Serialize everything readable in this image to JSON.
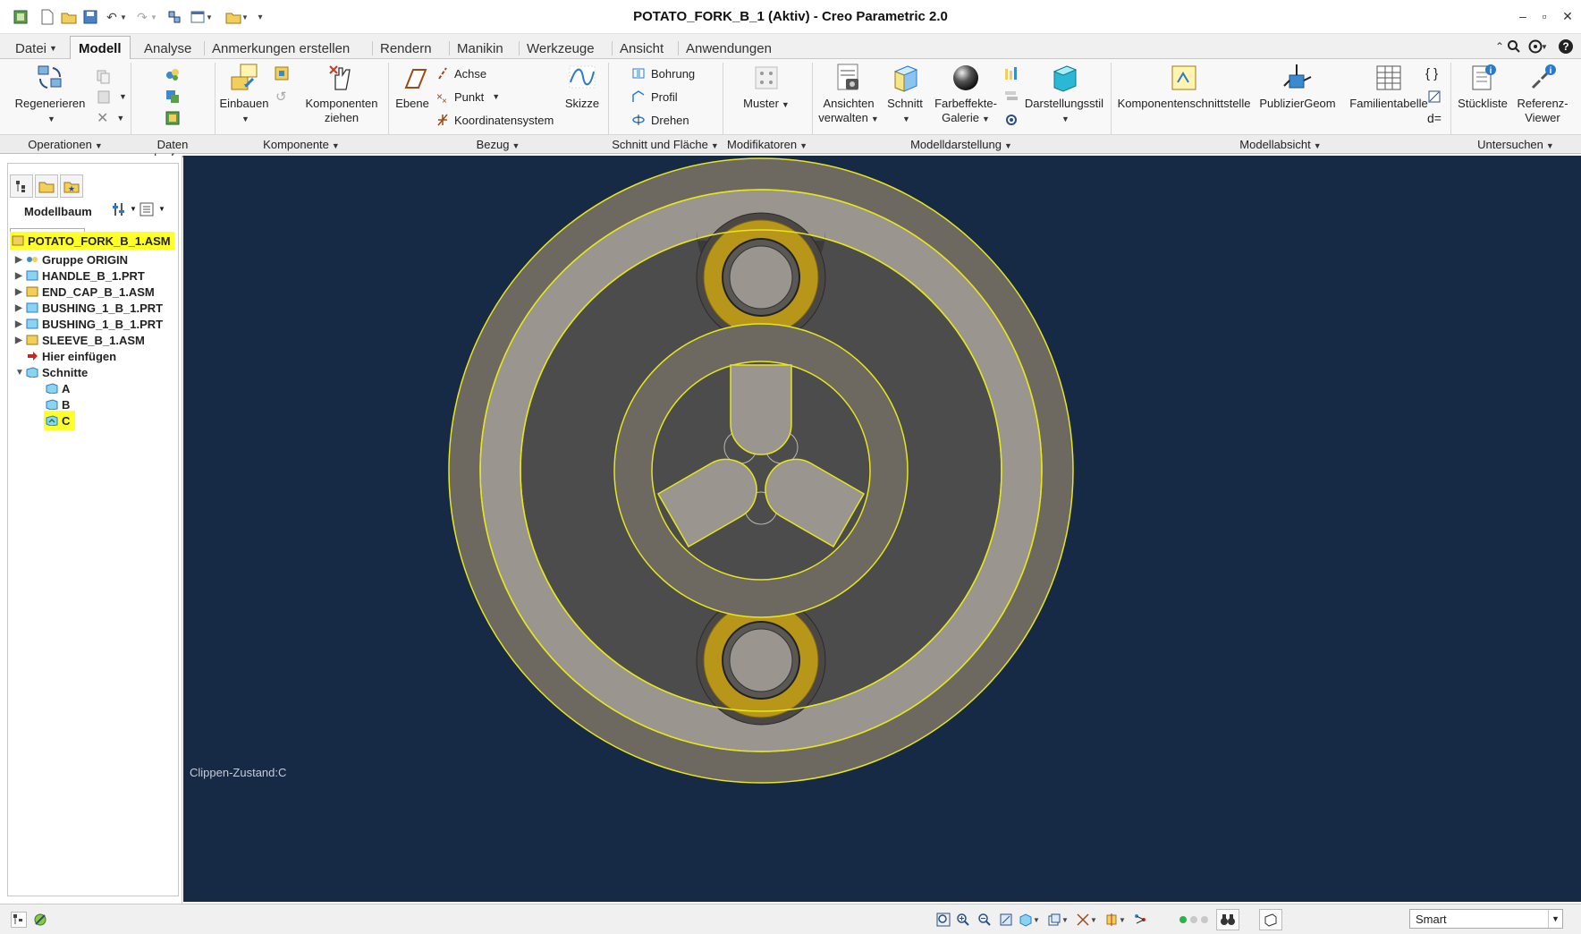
{
  "window": {
    "title": "POTATO_FORK_B_1 (Aktiv) - Creo Parametric 2.0"
  },
  "tabs": [
    {
      "label": "Datei"
    },
    {
      "label": "Modell"
    },
    {
      "label": "Analyse"
    },
    {
      "label": "Anmerkungen erstellen"
    },
    {
      "label": "Rendern"
    },
    {
      "label": "Manikin"
    },
    {
      "label": "Werkzeuge"
    },
    {
      "label": "Ansicht"
    },
    {
      "label": "Anwendungen"
    }
  ],
  "ribbon": {
    "regenerieren": "Regenerieren",
    "einbauen": "Einbauen",
    "komponenten_line1": "Komponenten",
    "komponenten_line2": "ziehen",
    "ebene": "Ebene",
    "achse": "Achse",
    "punkt": "Punkt",
    "koordinatensystem": "Koordinatensystem",
    "skizze": "Skizze",
    "bohrung": "Bohrung",
    "profil": "Profil",
    "drehen": "Drehen",
    "muster": "Muster",
    "ansichten_line1": "Ansichten",
    "ansichten_line2": "verwalten",
    "schnitt": "Schnitt",
    "farbeffekte_line1": "Farbeffekte-",
    "farbeffekte_line2": "Galerie",
    "darstellungsstil": "Darstellungsstil",
    "komponentenschnittstelle": "Komponentenschnittstelle",
    "publiziergeom": "PublizierGeom",
    "familientabelle": "Familientabelle",
    "stueckliste": "Stückliste",
    "referenz_line1": "Referenz-",
    "referenz_line2": "Viewer",
    "d_eq": "d="
  },
  "groups": {
    "operationen": "Operationen",
    "daten_abrufen": "Daten abrufen",
    "komponente": "Komponente",
    "bezug": "Bezug",
    "schnitt_flaeche": "Schnitt und Fläche",
    "modifikatoren": "Modifikatoren",
    "modelldarstellung": "Modelldarstellung",
    "modellabsicht": "Modellabsicht",
    "untersuchen": "Untersuchen"
  },
  "panel": {
    "title": "Modellbaum",
    "search_value": "",
    "tree": [
      {
        "label": "POTATO_FORK_B_1.ASM"
      },
      {
        "label": "Gruppe ORIGIN"
      },
      {
        "label": "HANDLE_B_1.PRT"
      },
      {
        "label": "END_CAP_B_1.ASM"
      },
      {
        "label": "BUSHING_1_B_1.PRT"
      },
      {
        "label": "BUSHING_1_B_1.PRT"
      },
      {
        "label": "SLEEVE_B_1.ASM"
      },
      {
        "label": "Hier einfügen"
      },
      {
        "label": "Schnitte"
      },
      {
        "label": "A"
      },
      {
        "label": "B"
      },
      {
        "label": "C"
      }
    ]
  },
  "viewport": {
    "clip_state": "Clippen-Zustand:C"
  },
  "statusbar": {
    "selection_filter": "Smart"
  },
  "colors": {
    "viewport_bg": "#172a45",
    "highlight": "#ffff2a",
    "edge": "#e6e61e",
    "bushing": "#b8961a"
  }
}
